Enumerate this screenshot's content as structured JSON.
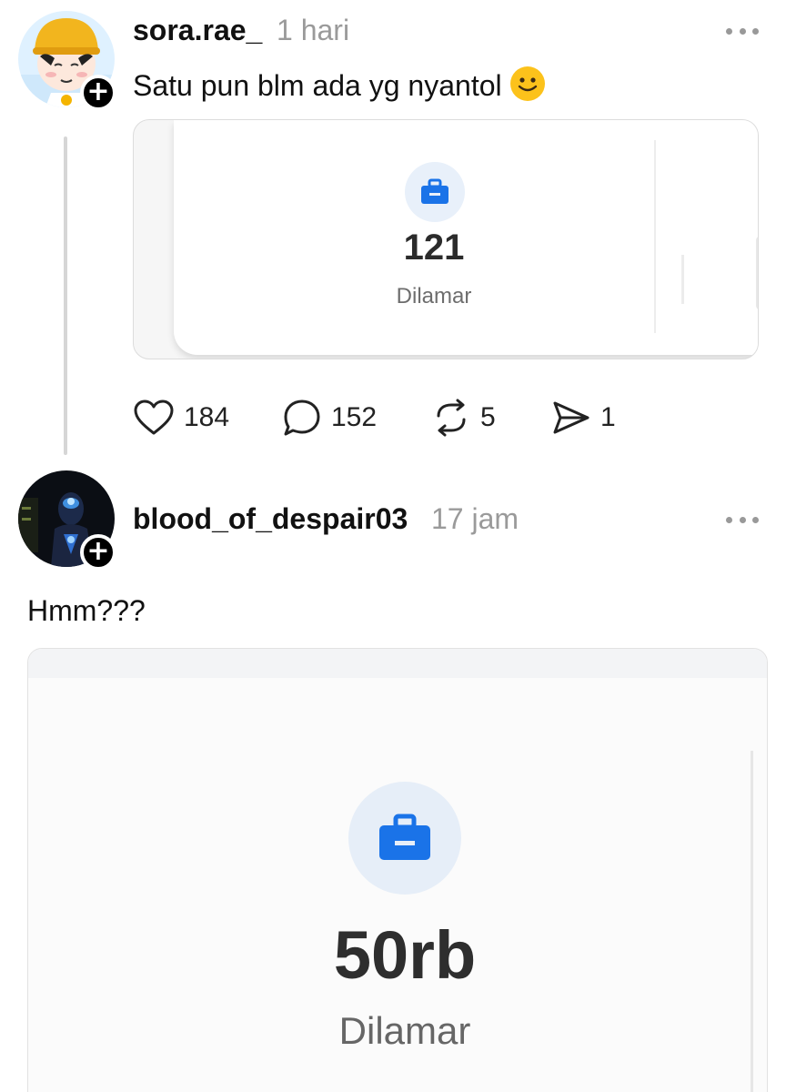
{
  "posts": [
    {
      "username": "sora.rae_",
      "time": "1 hari",
      "text": "Satu pun blm ada yg nyantol",
      "card": {
        "value": "121",
        "label": "Dilamar",
        "icon": "briefcase-icon"
      },
      "actions": {
        "likes": "184",
        "comments": "152",
        "reposts": "5",
        "shares": "1"
      }
    },
    {
      "username": "blood_of_despair03",
      "time": "17 jam",
      "text": "Hmm???",
      "card": {
        "value": "50rb",
        "label": "Dilamar",
        "icon": "briefcase-icon"
      }
    }
  ],
  "colors": {
    "accent_blue": "#1a73e8",
    "icon_bg": "#e8f0fa",
    "muted": "#9a9a9a"
  }
}
